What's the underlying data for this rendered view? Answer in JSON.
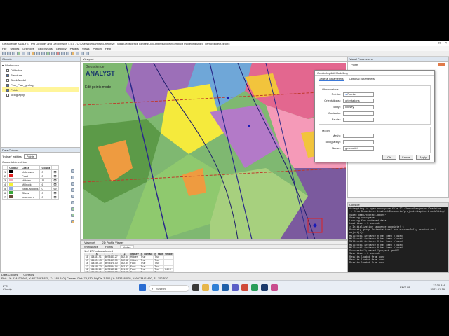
{
  "window": {
    "title": "Geoscience ANALYST Pro Geology and Geophysics 4.5.0 - C:\\Users\\BenjaminA\\OneDrive - Mira Geoscience Limited\\Documents\\projects\\implicit modelling\\video_demo\\project.geoh5"
  },
  "menu": [
    "File",
    "Utilities",
    "Drillholes",
    "Geophysics",
    "Geology",
    "Panels",
    "Views",
    "Python",
    "Help"
  ],
  "objects_panel": {
    "title": "Objects",
    "items": [
      {
        "label": "Workspace",
        "checked": false
      },
      {
        "label": "Drillholes",
        "checked": false
      },
      {
        "label": "Structure",
        "checked": true
      },
      {
        "label": "Block Model",
        "checked": false
      },
      {
        "label": "Plan_Plan_geology",
        "checked": true
      },
      {
        "label": "Points",
        "checked": true,
        "highlighted": true
      },
      {
        "label": "topography",
        "checked": false
      }
    ]
  },
  "data_colours": {
    "title": "Data Colours",
    "label_a": "'lindsay' entities",
    "selected": "Points",
    "table_label": "Colour table entries",
    "headers": [
      "Colour",
      "Class",
      "Count"
    ],
    "rows": [
      {
        "num": "1",
        "color": "#000000",
        "cls": "Unknown",
        "count": "0"
      },
      {
        "num": "2",
        "color": "#e02020",
        "cls": "Fault",
        "count": "0"
      },
      {
        "num": "3",
        "color": "#f3a6b8",
        "cls": "Hidden",
        "count": "11"
      },
      {
        "num": "4",
        "color": "#f5f232",
        "cls": "Millrock",
        "count": "6"
      },
      {
        "num": "5",
        "color": "#8ea8e6",
        "cls": "BlueLagoons",
        "count": "0"
      },
      {
        "num": "6",
        "color": "#3aa83a",
        "cls": "Glass",
        "count": "0"
      },
      {
        "num": "7",
        "color": "#6b4c3b",
        "cls": "basement",
        "count": "0"
      }
    ]
  },
  "viewer": {
    "title": "Viewport",
    "logo_top": "Geoscience",
    "logo_bottom": "ANALYST",
    "mode": "Edit points mode"
  },
  "implicit_dialog": {
    "title": "Geoflo Implicit Modelling",
    "tabs": [
      "General parameters",
      "Optional parameters"
    ],
    "obs_label": "Observations",
    "fields": [
      {
        "label": "Points :",
        "value": "Points"
      },
      {
        "label": "Orientations :",
        "value": "orientations"
      },
      {
        "label": "Entity :",
        "value": "lindsey"
      },
      {
        "label": "Contacts :",
        "value": ""
      },
      {
        "label": "Faults :",
        "value": ""
      }
    ],
    "model_label": "Model",
    "mesh_label": "Mesh :",
    "topo_label": "Topography :",
    "name_label": "Name :",
    "name_value": "geomodel",
    "buttons": [
      "OK",
      "Cancel",
      "Apply"
    ]
  },
  "visual_params": {
    "title": "Visual Parameters",
    "field_points": "Points"
  },
  "console": {
    "title": "Console",
    "lines": [
      "Attempting to open workspace file \"C:/Users/BenjaminA/OneDrive",
      " - Mira Geoscience Limited/Documents/projects/implicit modelling/",
      "video_demo/project.geoh5\"",
      "Opening workspace...",
      "Looking for orphaned data...",
      "Load time : 3 seconds",
      "> Initialization sequence complete! <",
      "Property group \"orientations\" was successfully created on 1",
      "object(s).",
      "Millrock1 instance 0 has been closed",
      "Millrock1 instance 0 has been closed",
      "Millrock1 instance 0 has been closed",
      "Millrock1 instance 0 has been closed",
      "Millrock1 instance 0 has been closed",
      "Successfully saved \"project.geoh5\"",
      "Save time : 2 seconds",
      "Results loaded from done",
      "Results loaded from done",
      "Results loaded from done"
    ]
  },
  "table_panel": {
    "tabs": [
      "Workspace",
      "Points",
      "Nodes"
    ],
    "view_tabs": [
      "Viewport",
      "2D Profile Viewer"
    ],
    "summary": "1 of 27 Nodes selected",
    "headers": [
      "",
      "X",
      "Y",
      "Z",
      "lindsey",
      "is_contact",
      "is_fault",
      "visible"
    ],
    "rows": [
      [
        "18",
        "314481.91",
        "6073481.27",
        "302.54",
        "Hidden",
        "True",
        "True",
        ""
      ],
      [
        "19",
        "314424.43",
        "6073469.30",
        "302.52",
        "Hidden",
        "True",
        "True",
        ""
      ],
      [
        "16",
        "314456.30",
        "6073478.00",
        "302.54",
        "Fault",
        "True",
        "True",
        ""
      ],
      [
        "17",
        "314495.73",
        "6073534.04",
        "302.52",
        "Fault",
        "True",
        "True",
        ""
      ],
      [
        "18",
        "314430.21",
        "6073145.21",
        "201.00",
        "Fault",
        "True",
        "True",
        "240.0"
      ],
      [
        "19",
        "314457.41",
        "6073502.23",
        "302.55",
        "Fault",
        "True",
        "True",
        ""
      ],
      [
        "20",
        "314477.41",
        "6073548.04",
        "302.54",
        "Fault",
        "True",
        "True",
        ""
      ],
      [
        "21",
        "314390.47",
        "6073520.00",
        "270.00",
        "Fault",
        "False",
        "True",
        "357.3"
      ],
      [
        "22",
        "314285.57",
        "6073605.00",
        "300.00",
        "Fault",
        "False",
        "True",
        "335.0"
      ],
      [
        "23",
        "314477.41",
        "6073750.60",
        "300.00",
        "Millrock",
        "True",
        "False",
        ""
      ],
      [
        "24",
        "314262.803",
        "6073481.457",
        "299.87",
        "Millrock",
        "True",
        "False",
        ""
      ]
    ],
    "selected_row": 10
  },
  "statusbar": {
    "tabs": [
      "Data Colours",
      "Controls"
    ],
    "text": "Pick : X: 314432.660, Y: 6073483.870, Z: -188.910 | Camera Dist: 73,530, DipDir: 3.500 | X: 313748.005, Y: 6073441.460, Z: -252.530"
  },
  "taskbar": {
    "weather_temp": "2°C",
    "weather_desc": "Cloudy",
    "search_placeholder": "Search",
    "sys": "ENG US",
    "time": "12:30 AM",
    "date": "2023-01-19"
  }
}
